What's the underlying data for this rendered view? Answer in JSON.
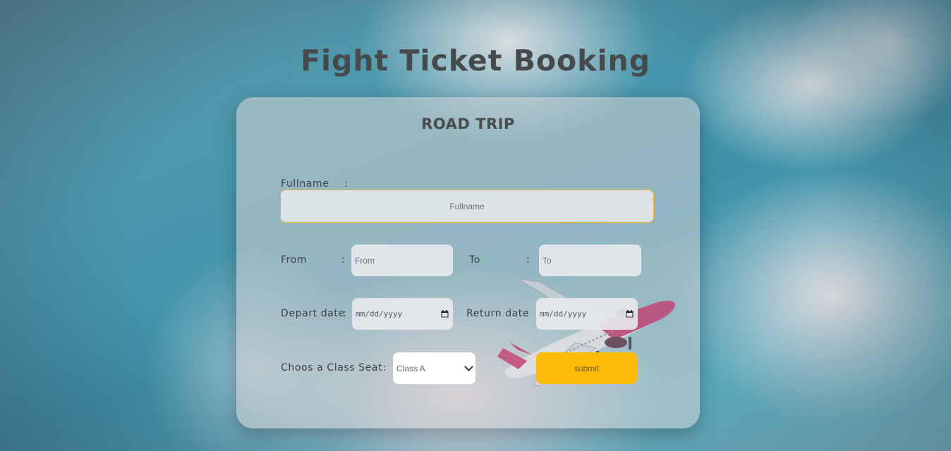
{
  "page": {
    "title": "Fight Ticket Booking"
  },
  "form": {
    "heading": "ROAD TRIP",
    "fullname": {
      "label": "Fullname",
      "placeholder": "Fullname"
    },
    "from": {
      "label": "From",
      "placeholder": "From"
    },
    "to": {
      "label": "To",
      "placeholder": "To"
    },
    "depart": {
      "label": "Depart date",
      "value": "mm/dd/yyyy"
    },
    "return": {
      "label": "Return date",
      "value": "mm/dd/yyyy"
    },
    "class_seat": {
      "label": "Choos a Class Seat",
      "selected": "Class A"
    },
    "colon": ":",
    "submit_label": "submit"
  },
  "colors": {
    "accent": "#fdbb0a",
    "input_focus_border": "#e7b52c"
  }
}
